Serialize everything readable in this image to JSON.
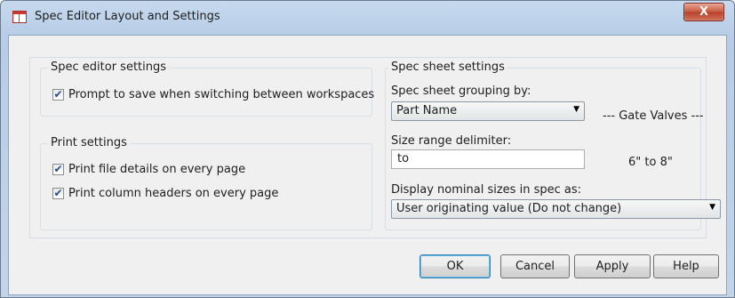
{
  "window": {
    "title": "Spec Editor Layout and Settings",
    "close_label": "X",
    "icon": "spec-sheet-icon"
  },
  "spec_editor_settings": {
    "title": "Spec editor settings",
    "prompt_to_save": {
      "label": "Prompt to save when switching between workspaces",
      "checked": true
    }
  },
  "print_settings": {
    "title": "Print settings",
    "file_details": {
      "label": "Print file details on every page",
      "checked": true
    },
    "column_headers": {
      "label": "Print column headers on every page",
      "checked": true
    }
  },
  "spec_sheet_settings": {
    "title": "Spec sheet settings",
    "grouping_label": "Spec sheet grouping by:",
    "grouping_value": "Part Name",
    "grouping_preview": "--- Gate Valves ---",
    "delimiter_label": "Size range delimiter:",
    "delimiter_value": "to",
    "delimiter_preview": "6\" to 8\"",
    "nominal_label": "Display nominal sizes in spec as:",
    "nominal_value": "User originating value (Do not change)"
  },
  "buttons": {
    "ok": "OK",
    "cancel": "Cancel",
    "apply": "Apply",
    "help": "Help"
  }
}
